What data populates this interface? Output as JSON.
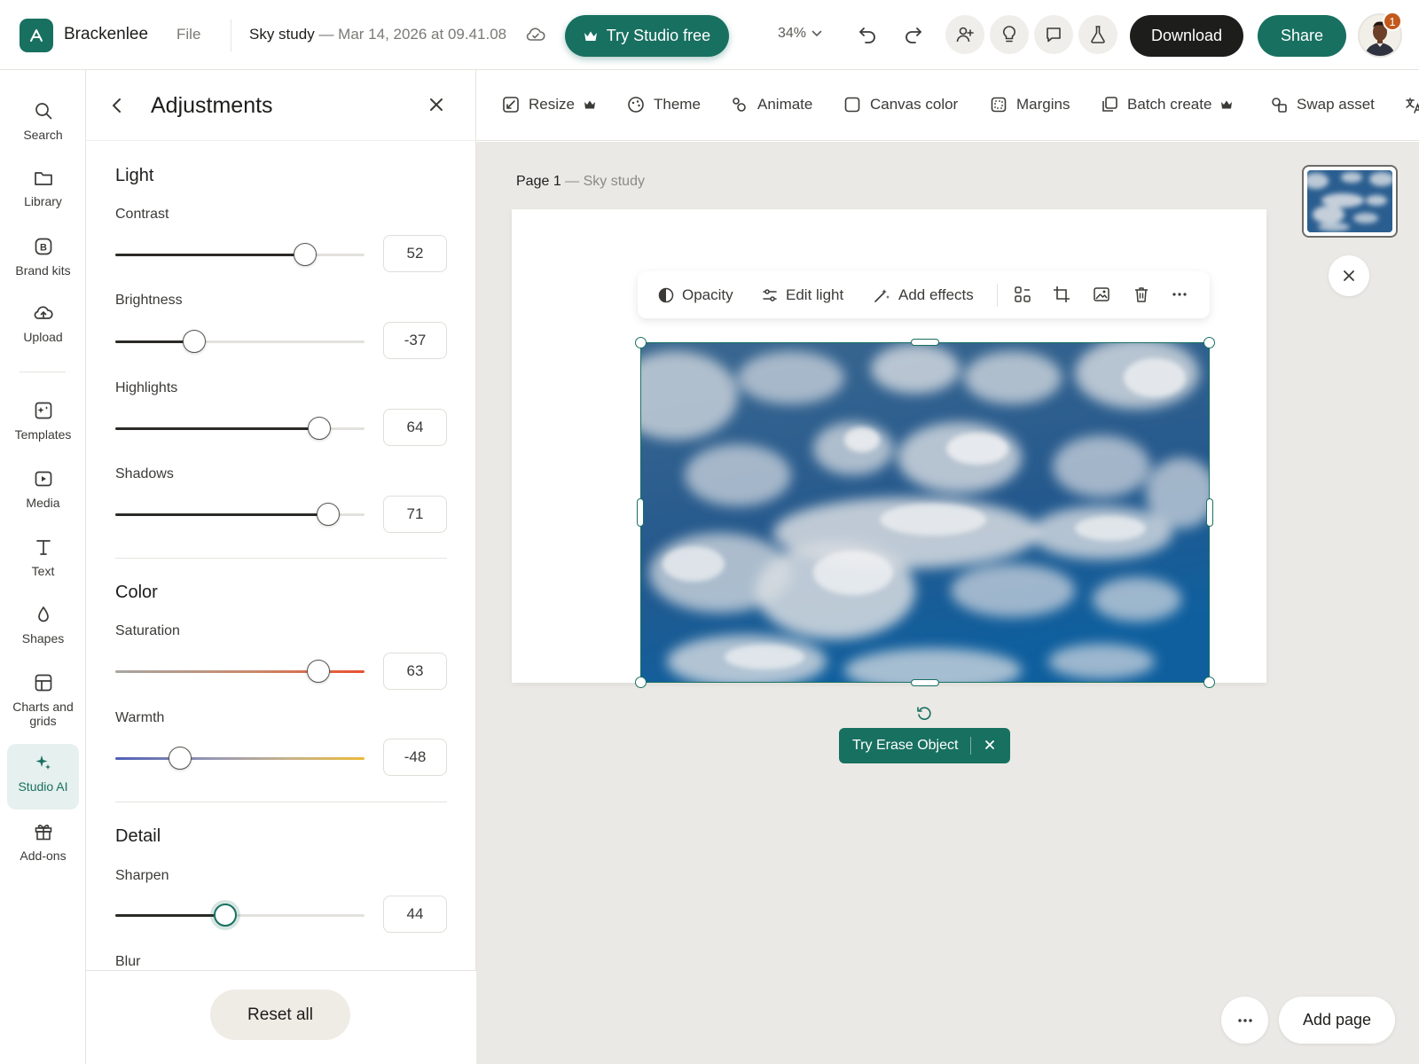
{
  "app": {
    "brand": "Brackenlee",
    "file_menu": "File"
  },
  "document": {
    "title": "Sky study",
    "subtitle": "— Mar 14, 2026 at 09.41.08"
  },
  "header": {
    "try_studio_label": "Try Studio free",
    "zoom": "34%",
    "download_label": "Download",
    "share_label": "Share",
    "notification_count": "1"
  },
  "leftnav": {
    "items": [
      {
        "label": "Search",
        "icon": "search-icon"
      },
      {
        "label": "Library",
        "icon": "folder-icon"
      },
      {
        "label": "Brand kits",
        "icon": "brand-kit-icon"
      },
      {
        "label": "Upload",
        "icon": "upload-icon"
      },
      {
        "label": "Templates",
        "icon": "templates-icon"
      },
      {
        "label": "Media",
        "icon": "media-icon"
      },
      {
        "label": "Text",
        "icon": "text-icon"
      },
      {
        "label": "Shapes",
        "icon": "shapes-icon"
      },
      {
        "label": "Charts and grids",
        "icon": "charts-icon"
      },
      {
        "label": "Studio AI",
        "icon": "sparkle-icon",
        "active": true
      },
      {
        "label": "Add-ons",
        "icon": "gift-icon"
      }
    ]
  },
  "panel": {
    "title": "Adjustments",
    "sections": {
      "light": "Light",
      "color": "Color",
      "detail": "Detail"
    },
    "sliders": {
      "contrast": {
        "label": "Contrast",
        "value": "52",
        "min": -100,
        "max": 100
      },
      "brightness": {
        "label": "Brightness",
        "value": "-37",
        "min": -100,
        "max": 100
      },
      "highlights": {
        "label": "Highlights",
        "value": "64",
        "min": -100,
        "max": 100
      },
      "shadows": {
        "label": "Shadows",
        "value": "71",
        "min": -100,
        "max": 100
      },
      "saturation": {
        "label": "Saturation",
        "value": "63",
        "min": -100,
        "max": 100
      },
      "warmth": {
        "label": "Warmth",
        "value": "-48",
        "min": -100,
        "max": 100
      },
      "sharpen": {
        "label": "Sharpen",
        "value": "44",
        "min": 0,
        "max": 100
      },
      "blur": {
        "label": "Blur"
      }
    },
    "reset_label": "Reset all"
  },
  "toolbar": {
    "items": [
      {
        "label": "Resize",
        "icon": "resize-icon",
        "premium": true
      },
      {
        "label": "Theme",
        "icon": "theme-icon"
      },
      {
        "label": "Animate",
        "icon": "animate-icon"
      },
      {
        "label": "Canvas color",
        "icon": "canvas-color-icon"
      },
      {
        "label": "Margins",
        "icon": "margins-icon"
      },
      {
        "label": "Batch create",
        "icon": "batch-create-icon",
        "premium": true
      },
      {
        "label": "Swap asset",
        "icon": "swap-asset-icon"
      }
    ]
  },
  "canvas": {
    "page_label": "Page 1",
    "page_sub": "— Sky study",
    "float_bar": {
      "opacity": "Opacity",
      "edit_light": "Edit light",
      "add_effects": "Add effects"
    },
    "erase_label": "Try Erase Object",
    "add_page_label": "Add page"
  },
  "colors": {
    "accent": "#187060",
    "dark_button": "#1d1d1b",
    "workspace_bg": "#ebe9e5",
    "badge": "#c2581c"
  }
}
